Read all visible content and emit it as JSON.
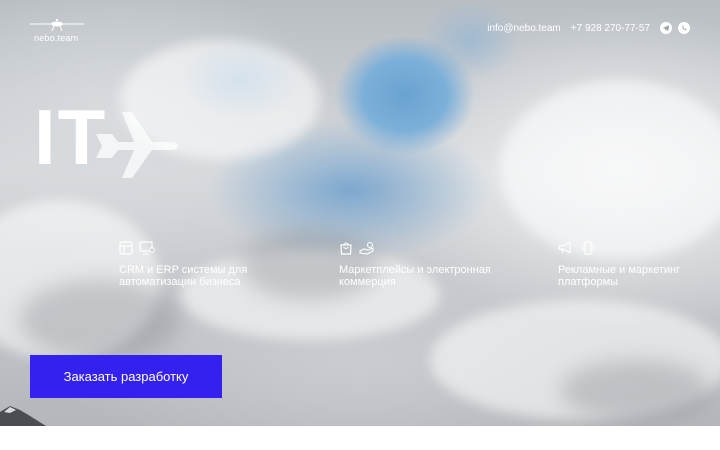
{
  "header": {
    "logo_text": "nebo.team",
    "email": "info@nebo.team",
    "phone": "+7 928 270-77-57",
    "icons": [
      "telegram-icon",
      "whatsapp-icon"
    ]
  },
  "hero": {
    "title": "IT",
    "title_icon": "airplane-icon"
  },
  "features": [
    {
      "icons": [
        "layout-icon",
        "monitor-settings-icon"
      ],
      "text": "CRM и ERP системы для\nавтоматизации бизнеса"
    },
    {
      "icons": [
        "shopping-bag-icon",
        "hand-coins-icon"
      ],
      "text": "Маркетплейсы и электронная\nкоммерция"
    },
    {
      "icons": [
        "megaphone-icon",
        "phone-vibrate-icon"
      ],
      "text": "Рекламные и маркетинг\nплатформы"
    }
  ],
  "cta": {
    "label": "Заказать разработку"
  },
  "colors": {
    "accent": "#3421f0",
    "text": "#ffffff"
  }
}
